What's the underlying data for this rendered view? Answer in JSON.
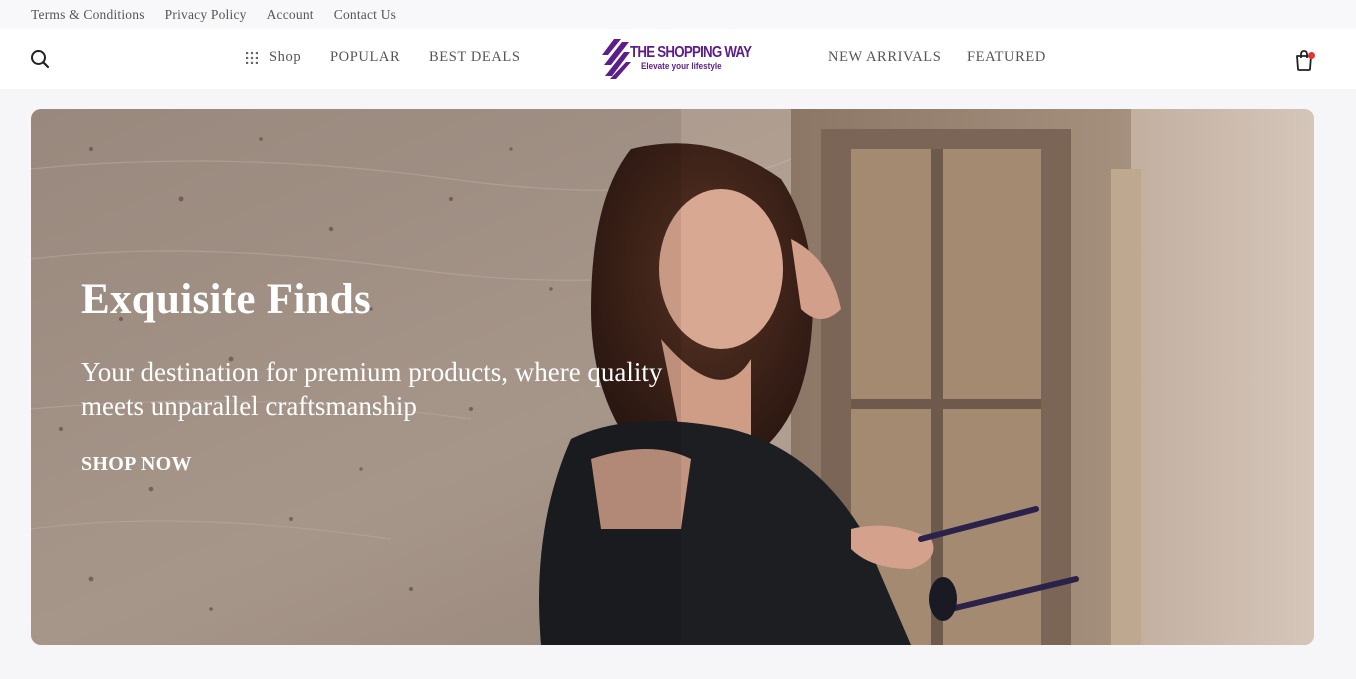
{
  "topbar": {
    "links": [
      "Terms & Conditions",
      "Privacy Policy",
      "Account",
      "Contact Us"
    ]
  },
  "nav": {
    "search_icon": "search-icon",
    "shop_label": "Shop",
    "shop_icon": "grid-icon",
    "popular_label": "POPULAR",
    "best_deals_label": "BEST DEALS",
    "new_arrivals_label": "NEW ARRIVALS",
    "featured_label": "FEATURED",
    "cart_icon": "shopping-bag-icon",
    "cart_badge_color": "#e8322e"
  },
  "logo": {
    "title": "THE SHOPPING WAY",
    "tagline": "Elevate your lifestyle",
    "color": "#5c1f8a"
  },
  "hero": {
    "title": "Exquisite Finds",
    "subtitle": "Your destination for premium products, where quality meets unparallel craftsmanship",
    "cta": "SHOP NOW"
  }
}
